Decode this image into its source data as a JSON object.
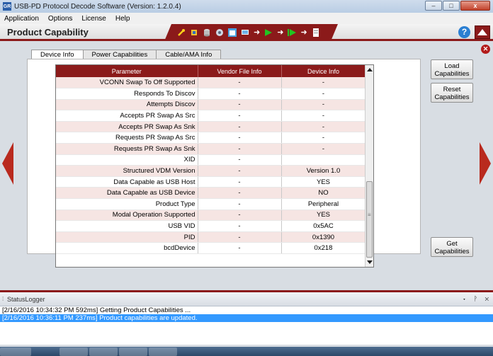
{
  "window": {
    "title": "USB-PD Protocol Decode Software (Version: 1.2.0.4)",
    "app_badge": "GR",
    "minimize": "–",
    "maximize": "□",
    "close": "x"
  },
  "menu": [
    "Application",
    "Options",
    "License",
    "Help"
  ],
  "header": {
    "title": "Product Capability",
    "help": "?"
  },
  "content": {
    "close_glyph": "✕"
  },
  "tabs": [
    {
      "label": "Device Info",
      "active": true
    },
    {
      "label": "Power Capabilities",
      "active": false
    },
    {
      "label": "Cable/AMA Info",
      "active": false
    }
  ],
  "table": {
    "columns": [
      "Parameter",
      "Vendor File Info",
      "Device Info"
    ],
    "rows": [
      [
        "VCONN Swap To Off Supported",
        "-",
        "-"
      ],
      [
        "Responds To Discov",
        "-",
        "-"
      ],
      [
        "Attempts Discov",
        "-",
        "-"
      ],
      [
        "Accepts PR Swap As Src",
        "-",
        "-"
      ],
      [
        "Accepts PR Swap As Snk",
        "-",
        "-"
      ],
      [
        "Requests PR Swap As Src",
        "-",
        "-"
      ],
      [
        "Requests PR Swap As Snk",
        "-",
        "-"
      ],
      [
        "XID",
        "-",
        ""
      ],
      [
        "Structured VDM Version",
        "-",
        "Version 1.0"
      ],
      [
        "Data Capable as USB Host",
        "-",
        "YES"
      ],
      [
        "Data Capable as USB Device",
        "-",
        "NO"
      ],
      [
        "Product Type",
        "-",
        "Peripheral"
      ],
      [
        "Modal Operation Supported",
        "-",
        "YES"
      ],
      [
        "USB VID",
        "-",
        "0x5AC"
      ],
      [
        "PID",
        "-",
        "0x1390"
      ],
      [
        "bcdDevice",
        "-",
        "0x218"
      ]
    ]
  },
  "buttons": {
    "load": [
      "Load",
      "Capabilities"
    ],
    "reset": [
      "Reset",
      "Capabilities"
    ],
    "get": [
      "Get",
      "Capabilities"
    ]
  },
  "status_logger": {
    "title": "StatusLogger",
    "controls": "▾ ᚹ ✕",
    "lines": [
      {
        "text": "[2/16/2016 10:34:32 PM 592ms] Getting Product Capabilities ...",
        "selected": false
      },
      {
        "text": "[2/16/2016 10:36:11 PM 237ms] Product capabilities are updated.",
        "selected": true
      }
    ]
  },
  "colors": {
    "accent": "#8b1a1a",
    "nav_arrow": "#b92a1e",
    "row_stripe": "#f6e5e3",
    "selection": "#3399ff"
  }
}
